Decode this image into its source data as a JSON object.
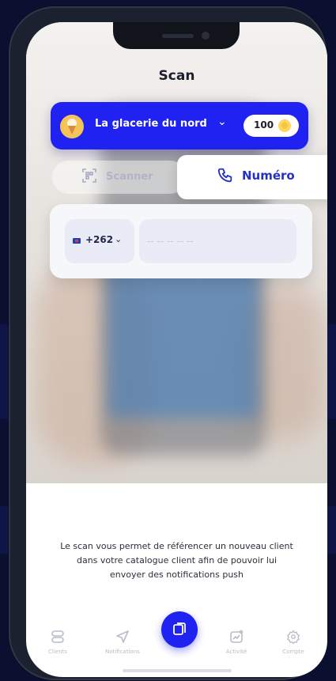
{
  "header": {
    "title": "Scan"
  },
  "store": {
    "name": "La glacerie du nord",
    "points": "100",
    "logo_icon": "ice-cream-icon",
    "coin_icon": "coin-icon"
  },
  "mode": {
    "scanner_label": "Scanner",
    "number_label": "Numéro",
    "selected": "number"
  },
  "phone_form": {
    "country_code": "+262",
    "placeholder": "-- -- -- -- --",
    "value": ""
  },
  "help_text": "Le scan vous permet de référencer un nouveau client dans votre catalogue client afin de pouvoir lui envoyer des notifications push",
  "tabbar": {
    "items": [
      {
        "label": "Clients",
        "icon": "clients-icon"
      },
      {
        "label": "Notifications",
        "icon": "send-icon"
      },
      {
        "label": "",
        "icon": "scan-icon"
      },
      {
        "label": "Activité",
        "icon": "activity-chart-icon"
      },
      {
        "label": "Compte",
        "icon": "gear-icon"
      }
    ]
  },
  "colors": {
    "primary": "#1f22f0",
    "accent_text": "#2530c8",
    "background": "#0b1030"
  }
}
